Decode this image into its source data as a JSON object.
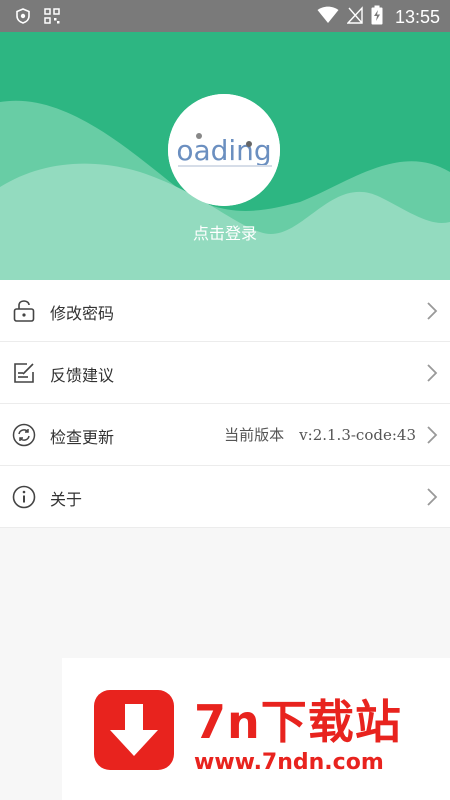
{
  "status_bar": {
    "time": "13:55",
    "icons": [
      "shield-icon",
      "qr-icon",
      "wifi-icon",
      "signal-off-icon",
      "battery-charging-icon"
    ]
  },
  "header": {
    "login_text": "点击登录",
    "avatar_text": "oading",
    "colors": {
      "green": "#2db682",
      "light_green": "#93dbbf",
      "mid_green": "#6fcfa9"
    }
  },
  "menu": {
    "items": [
      {
        "label": "修改密码",
        "icon": "unlock-icon"
      },
      {
        "label": "反馈建议",
        "icon": "edit-note-icon"
      },
      {
        "label": "检查更新",
        "icon": "refresh-icon",
        "value": "当前版本　v:2.1.3-code:43"
      },
      {
        "label": "关于",
        "icon": "info-icon"
      }
    ]
  },
  "watermark": {
    "title": "7n下载站",
    "url": "www.7ndn.com",
    "color": "#e8231e"
  }
}
